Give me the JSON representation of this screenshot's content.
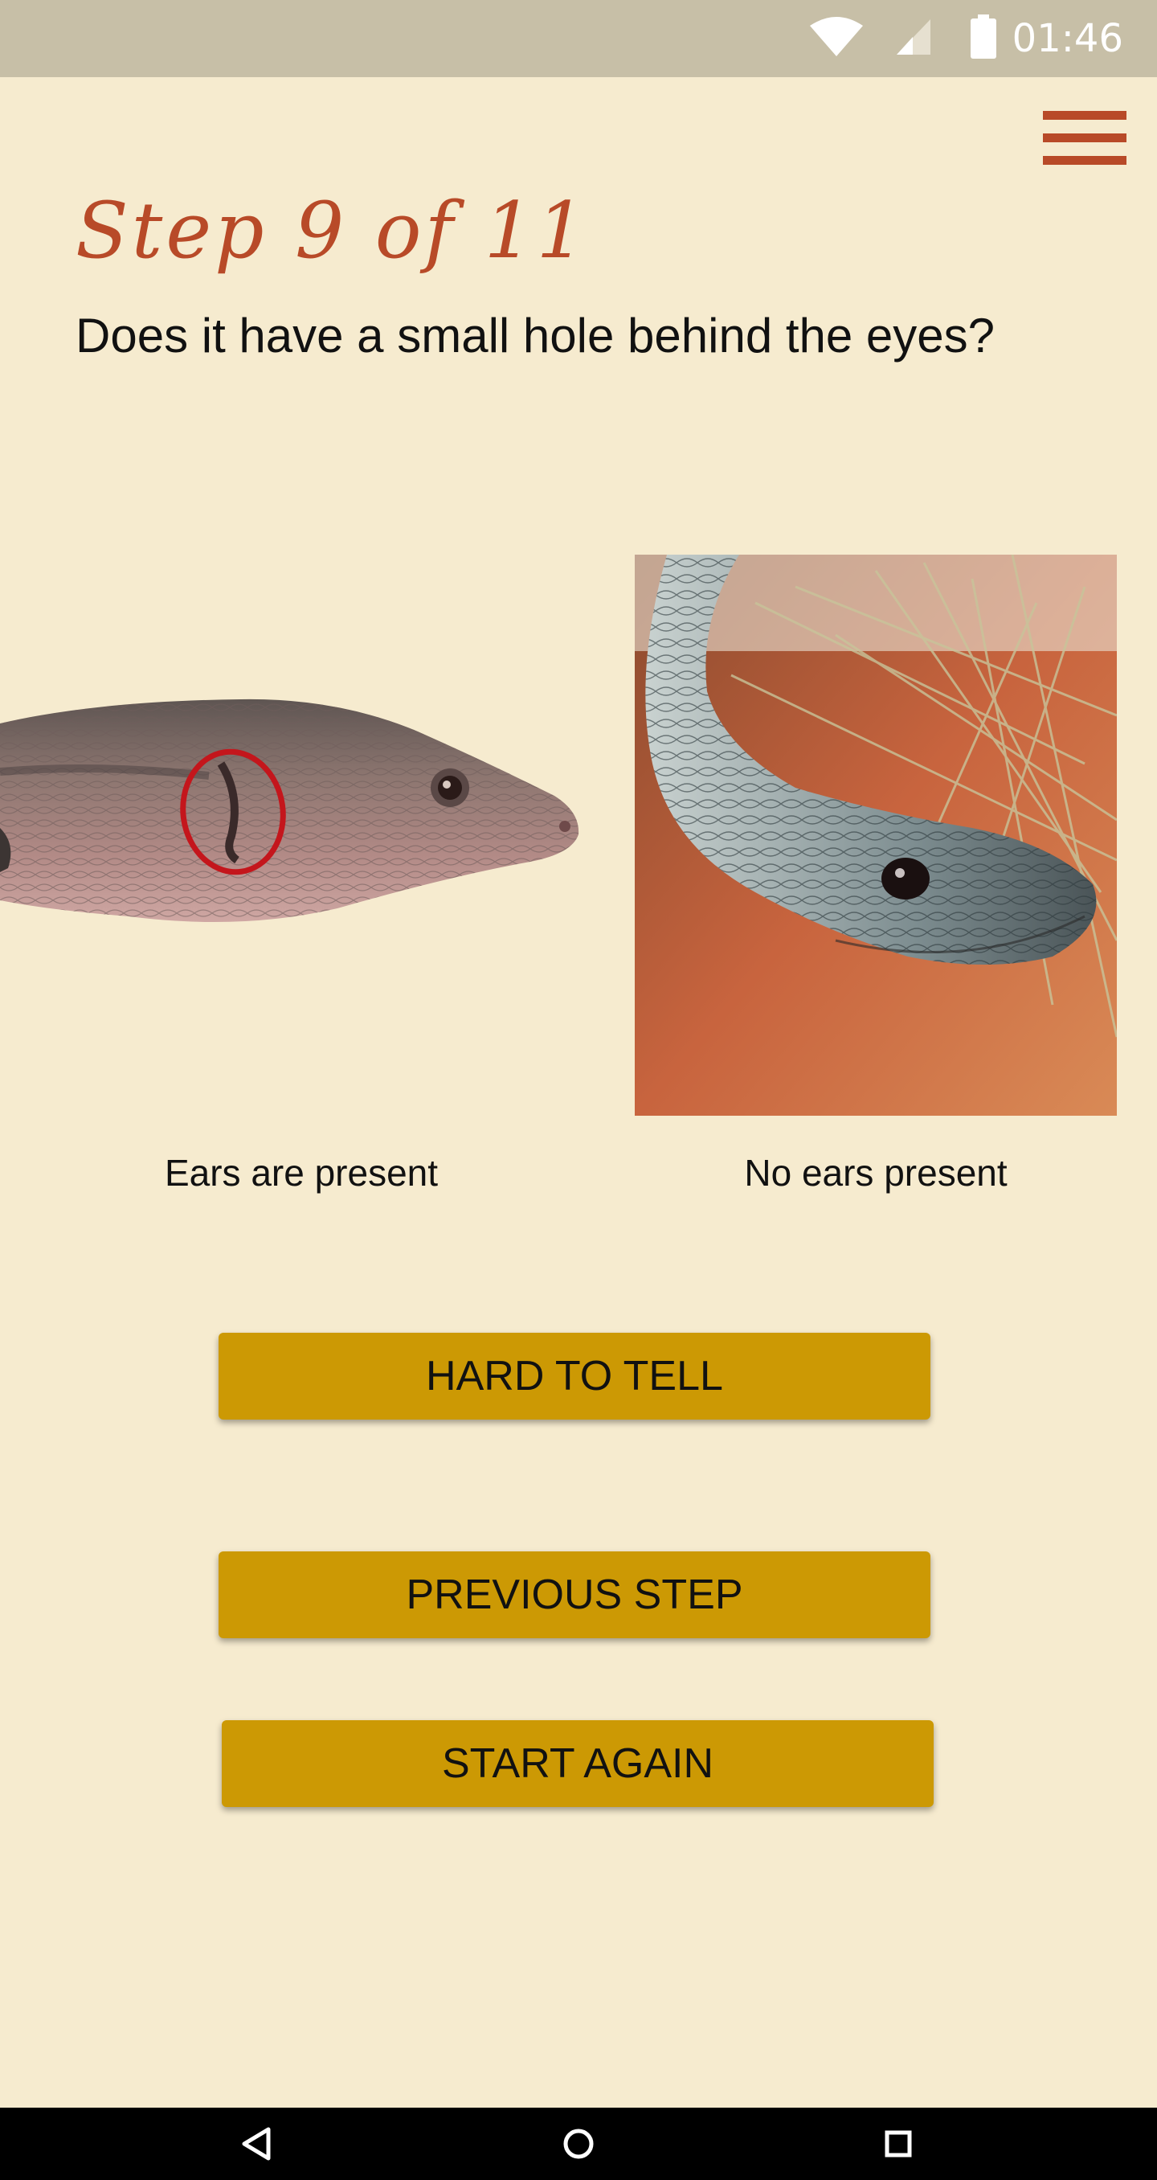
{
  "status_bar": {
    "time": "01:46",
    "icons": [
      "wifi-icon",
      "cell-signal-icon",
      "battery-icon"
    ]
  },
  "header": {
    "menu_icon": "hamburger-menu-icon",
    "step_title": "Step 9 of 11"
  },
  "question": "Does it have a small hole behind the eyes?",
  "options": [
    {
      "caption": "Ears are present",
      "image": "legless-lizard-head-with-ear-hole-circled"
    },
    {
      "caption": "No ears present",
      "image": "snake-head-without-ear-hole-photo"
    }
  ],
  "buttons": {
    "hard_to_tell": "HARD TO TELL",
    "previous_step": "PREVIOUS STEP",
    "start_again": "START AGAIN"
  },
  "nav_bar": {
    "icons": [
      "back-triangle-icon",
      "home-circle-icon",
      "recent-apps-square-icon"
    ]
  },
  "colors": {
    "background": "#f6ebcf",
    "accent": "#b84a28",
    "button": "#cc9904",
    "status_bar": "#c7bfa7",
    "ear_highlight": "#c4161c"
  }
}
